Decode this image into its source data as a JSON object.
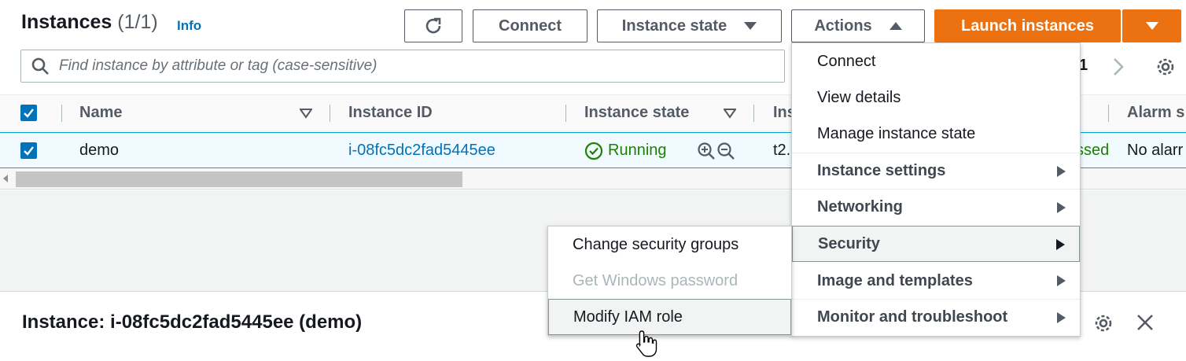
{
  "header": {
    "title": "Instances",
    "count": "(1/1)",
    "info": "Info",
    "buttons": {
      "connect": "Connect",
      "instance_state": "Instance state",
      "actions": "Actions",
      "launch": "Launch instances"
    }
  },
  "search": {
    "placeholder": "Find instance by attribute or tag (case-sensitive)"
  },
  "pagination": {
    "page": "1"
  },
  "table": {
    "columns": [
      "Name",
      "Instance ID",
      "Instance state",
      "Ins",
      "Alarm s"
    ],
    "rows": [
      {
        "name": "demo",
        "instance_id": "i-08fc5dc2fad5445ee",
        "state": "Running",
        "type": "t2.",
        "status_check": "ssed",
        "alarm": "No alarr"
      }
    ]
  },
  "actions_menu": {
    "items": [
      "Connect",
      "View details",
      "Manage instance state",
      "Instance settings",
      "Networking",
      "Security",
      "Image and templates",
      "Monitor and troubleshoot"
    ]
  },
  "security_submenu": {
    "items": [
      "Change security groups",
      "Get Windows password",
      "Modify IAM role"
    ]
  },
  "detail": {
    "title": "Instance: i-08fc5dc2fad5445ee (demo)"
  },
  "colors": {
    "accent": "#0073bb",
    "launch": "#ec7211",
    "running": "#1d8102"
  }
}
